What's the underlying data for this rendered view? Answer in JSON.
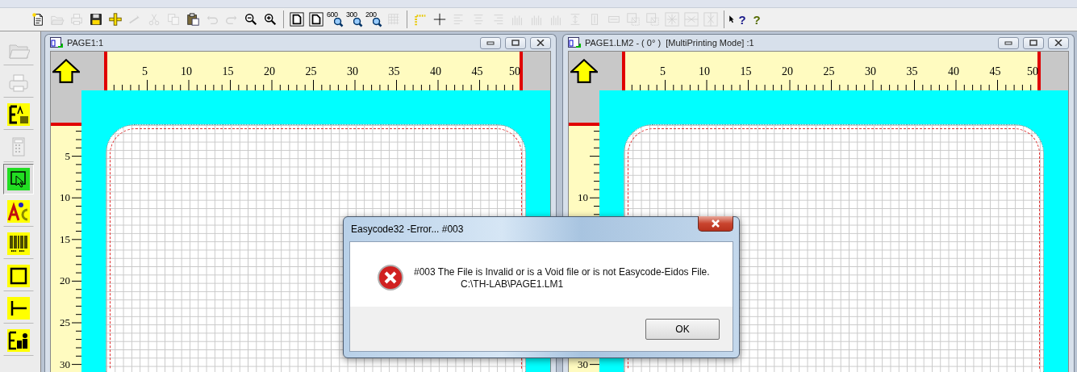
{
  "toolbar": [
    {
      "kind": "new",
      "disabled": false
    },
    {
      "kind": "open",
      "disabled": true
    },
    {
      "kind": "print",
      "disabled": true
    },
    {
      "kind": "save",
      "disabled": false
    },
    {
      "kind": "tool",
      "disabled": false
    },
    {
      "kind": "wand",
      "disabled": true
    },
    {
      "kind": "cut",
      "disabled": true
    },
    {
      "kind": "copy",
      "disabled": true
    },
    {
      "kind": "paste",
      "disabled": false
    },
    {
      "kind": "undo",
      "disabled": true
    },
    {
      "kind": "redo",
      "disabled": true
    },
    {
      "kind": "zoomout",
      "disabled": false
    },
    {
      "kind": "zoomin",
      "disabled": false
    },
    {
      "kind": "sep"
    },
    {
      "kind": "page",
      "disabled": false
    },
    {
      "kind": "page2",
      "disabled": false
    },
    {
      "kind": "zoomlabel",
      "label": "600",
      "disabled": false
    },
    {
      "kind": "zoomlabel",
      "label": "300",
      "disabled": false
    },
    {
      "kind": "zoomlabel",
      "label": "200",
      "disabled": false
    },
    {
      "kind": "grid",
      "disabled": true
    },
    {
      "kind": "sep"
    },
    {
      "kind": "corner",
      "disabled": false
    },
    {
      "kind": "cross",
      "disabled": false
    },
    {
      "kind": "alignleft",
      "disabled": true
    },
    {
      "kind": "aligncenter",
      "disabled": true
    },
    {
      "kind": "alignright",
      "disabled": true
    },
    {
      "kind": "bars",
      "disabled": true
    },
    {
      "kind": "bars",
      "disabled": true
    },
    {
      "kind": "bars",
      "disabled": true
    },
    {
      "kind": "spacing",
      "disabled": true
    },
    {
      "kind": "vcenter",
      "disabled": true
    },
    {
      "kind": "hcenter",
      "disabled": true
    },
    {
      "kind": "boxarrow",
      "disabled": true
    },
    {
      "kind": "boxarrow",
      "disabled": true
    },
    {
      "kind": "boxstar",
      "disabled": true
    },
    {
      "kind": "boxsplit",
      "disabled": true
    },
    {
      "kind": "boxvsplit",
      "disabled": true
    },
    {
      "kind": "sep"
    },
    {
      "kind": "helparrow",
      "label": "?",
      "disabled": false
    },
    {
      "kind": "helpbulb",
      "label": "?",
      "disabled": false
    }
  ],
  "tools": [
    {
      "kind": "folder",
      "disabled": true,
      "selected": false
    },
    {
      "kind": "printer",
      "disabled": true,
      "selected": false
    },
    {
      "kind": "logo",
      "disabled": false,
      "selected": false
    },
    {
      "kind": "calculator",
      "disabled": true,
      "selected": false
    },
    {
      "kind": "select",
      "disabled": false,
      "selected": true
    },
    {
      "kind": "text",
      "disabled": false,
      "selected": false
    },
    {
      "kind": "barcode",
      "disabled": false,
      "selected": false
    },
    {
      "kind": "rectangle",
      "disabled": false,
      "selected": false
    },
    {
      "kind": "line",
      "disabled": false,
      "selected": false
    },
    {
      "kind": "image",
      "disabled": false,
      "selected": false
    }
  ],
  "windows": [
    {
      "title": "PAGE1:1",
      "top_ruler": [
        "5",
        "10",
        "15",
        "20",
        "25",
        "30",
        "35",
        "40",
        "45",
        "50"
      ],
      "left_ruler": [
        "5",
        "10",
        "15",
        "20",
        "25",
        "30"
      ]
    },
    {
      "title": "PAGE1.LM2 - ( 0° )  [MultiPrinting Mode] :1",
      "top_ruler": [
        "5",
        "10",
        "15",
        "20",
        "25",
        "30",
        "35",
        "40",
        "45",
        "50"
      ],
      "left_ruler": [
        "10",
        "30"
      ]
    }
  ],
  "dialog": {
    "title": "Easycode32 -Error... #003",
    "message": "#003 The File is Invalid or is a Void file or is not Easycode-Eidos File.",
    "path": "C:\\TH-LAB\\PAGE1.LM1",
    "buttons": [
      "OK"
    ]
  }
}
